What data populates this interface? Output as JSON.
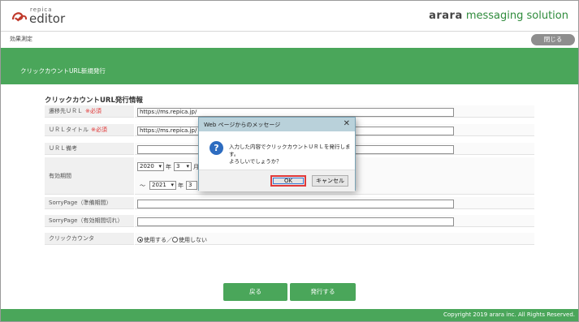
{
  "header": {
    "logo_small": "repica",
    "logo_main": "editor",
    "brand_bold": "arara",
    "brand_rest": " messaging solution"
  },
  "subbar": {
    "label": "効果測定",
    "close_label": "閉じる"
  },
  "titlebar": {
    "text": "クリックカウントURL新規発行"
  },
  "section": {
    "title": "クリックカウントURL発行情報"
  },
  "form": {
    "required_mark": "※必須",
    "rows": [
      {
        "label": "遷移先ＵＲＬ",
        "value": "https://ms.repica.jp/"
      },
      {
        "label": "ＵＲＬタイトル",
        "value": "https://ms.repica.jp/"
      },
      {
        "label": "ＵＲＬ備考",
        "value": ""
      },
      {
        "label": "有効期間"
      },
      {
        "label": "SorryPage（準備期間）",
        "value": ""
      },
      {
        "label": "SorryPage（有効期間切れ）",
        "value": ""
      },
      {
        "label": "クリックカウンタ"
      }
    ],
    "period": {
      "start_year": "2020",
      "start_month": "3",
      "year_unit": "年",
      "month_unit": "月",
      "tilde": "～",
      "end_year": "2021",
      "end_month": "3"
    },
    "counter": {
      "use": "使用する／",
      "not_use": "使用しない"
    }
  },
  "buttons": {
    "back": "戻る",
    "issue": "発行する"
  },
  "footer": {
    "copyright": "Copyright 2019 arara inc. All Rights Reserved."
  },
  "dialog": {
    "title": "Web ページからのメッセージ",
    "close": "✕",
    "icon": "?",
    "message_line1": "入力した内容でクリックカウントＵＲＬを発行します。",
    "message_line2": "よろしいでしょうか？",
    "ok": "OK",
    "cancel": "キャンセル"
  },
  "colors": {
    "accent_green": "#4aa65a",
    "required_red": "#e03030",
    "dialog_title": "#b9d1da"
  }
}
